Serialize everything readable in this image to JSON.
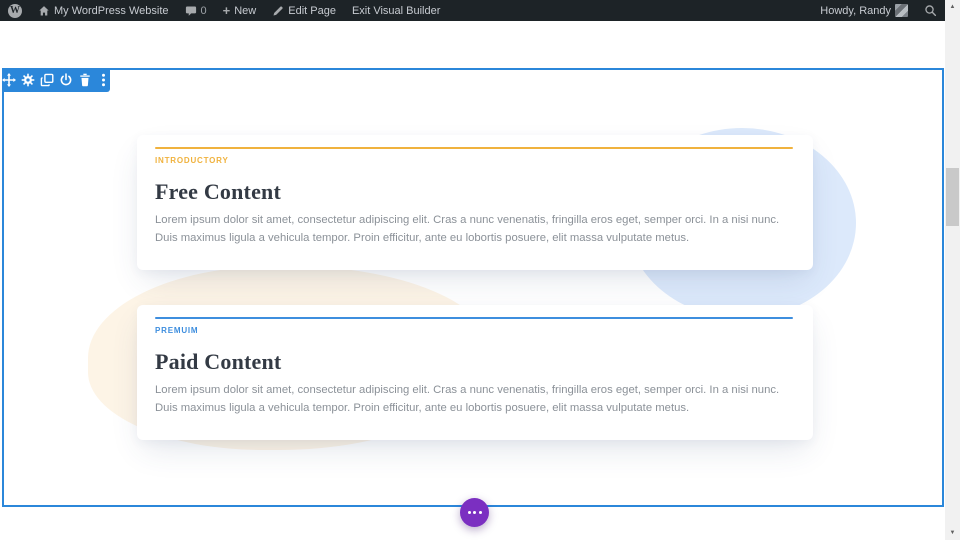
{
  "admin_bar": {
    "site_name": "My WordPress Website",
    "comments_count": "0",
    "new_label": "New",
    "edit_page_label": "Edit Page",
    "exit_builder_label": "Exit Visual Builder",
    "howdy_label": "Howdy, Randy"
  },
  "builder": {
    "toolbar_icons": [
      {
        "name": "move-icon"
      },
      {
        "name": "settings-gear-icon"
      },
      {
        "name": "duplicate-icon"
      },
      {
        "name": "disable-power-icon"
      },
      {
        "name": "delete-trash-icon"
      },
      {
        "name": "more-options-icon"
      }
    ],
    "page_settings_icon": "ellipsis-icon"
  },
  "content": {
    "cards": [
      {
        "label": "INTRODUCTORY",
        "title": "Free Content",
        "body": "Lorem ipsum dolor sit amet, consectetur adipiscing elit. Cras a nunc venenatis, fringilla eros eget, semper orci. In a nisi nunc. Duis maximus ligula a vehicula tempor. Proin efficitur, ante eu lobortis posuere, elit massa vulputate metus.",
        "accent": "#f0b23e"
      },
      {
        "label": "PREMUIM",
        "title": "Paid Content",
        "body": "Lorem ipsum dolor sit amet, consectetur adipiscing elit. Cras a nunc venenatis, fringilla eros eget, semper orci. In a nisi nunc. Duis maximus ligula a vehicula tempor. Proin efficitur, ante eu lobortis posuere, elit massa vulputate metus.",
        "accent": "#3e8ede"
      }
    ]
  },
  "colors": {
    "admin_bar_bg": "#1d2327",
    "builder_blue": "#2b87da",
    "accent_gold": "#f0b23e",
    "accent_blue": "#3e8ede",
    "settings_purple": "#7b2fc1",
    "blob_blue": "#dce9fb",
    "blob_cream": "#fdf4e6",
    "heading_color": "#333a44",
    "body_text_color": "#8b9198"
  }
}
